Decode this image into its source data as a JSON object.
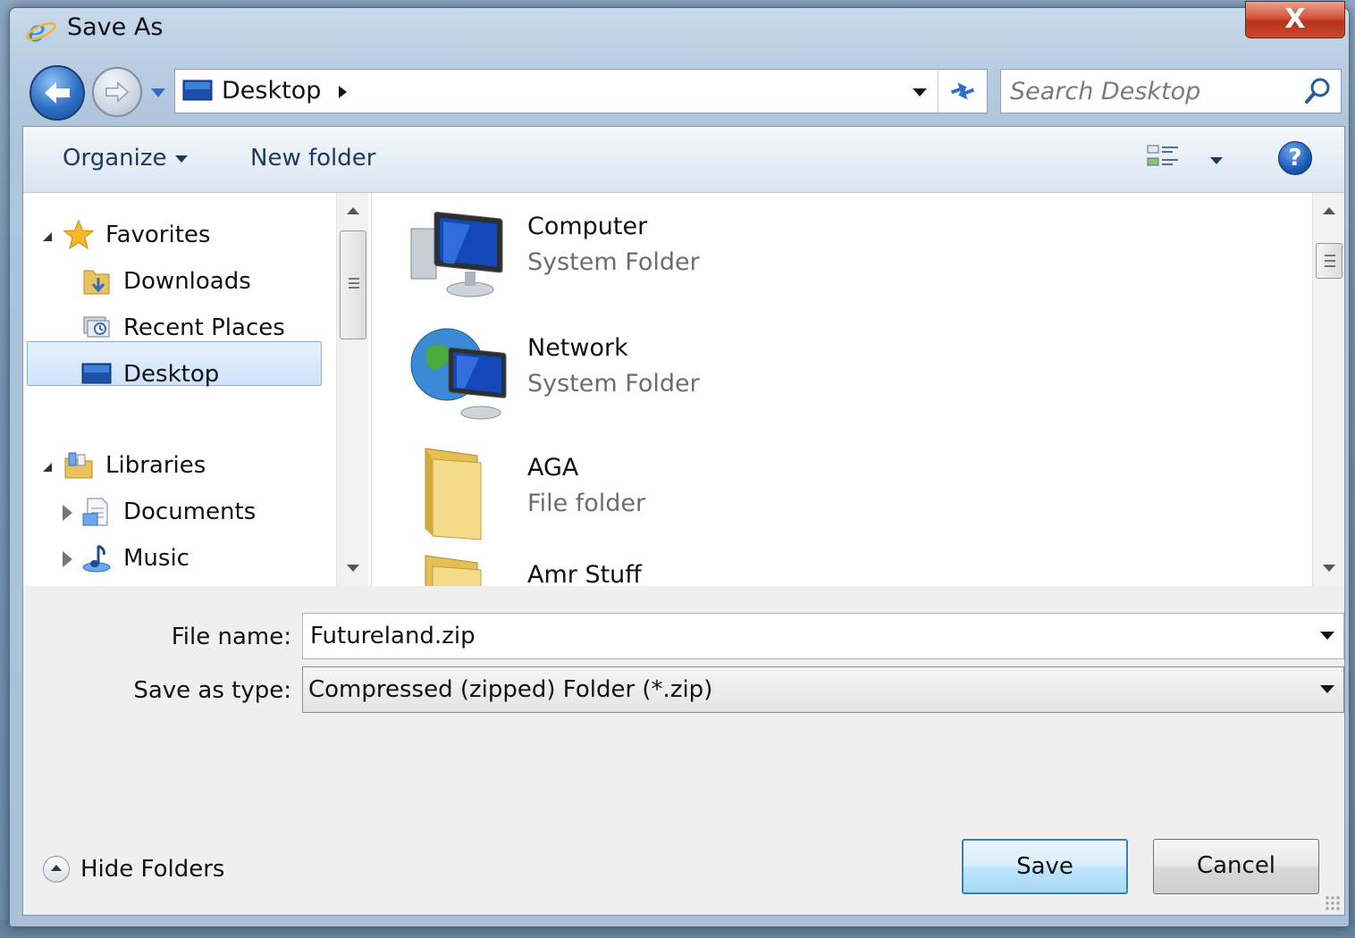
{
  "window": {
    "title": "Save As",
    "close_label": "X"
  },
  "address": {
    "location": "Desktop",
    "search_placeholder": "Search Desktop"
  },
  "toolbar": {
    "organize_label": "Organize",
    "new_folder_label": "New folder",
    "help_label": "?"
  },
  "nav": {
    "favorites_label": "Favorites",
    "favorites": [
      {
        "label": "Downloads"
      },
      {
        "label": "Recent Places"
      },
      {
        "label": "Desktop"
      }
    ],
    "libraries_label": "Libraries",
    "libraries": [
      {
        "label": "Documents"
      },
      {
        "label": "Music"
      }
    ],
    "selected": "Desktop"
  },
  "files": [
    {
      "name": "Computer",
      "type": "System Folder",
      "icon": "computer-icon"
    },
    {
      "name": "Network",
      "type": "System Folder",
      "icon": "network-icon"
    },
    {
      "name": "AGA",
      "type": "File folder",
      "icon": "folder-icon"
    },
    {
      "name": "Amr Stuff",
      "type": "",
      "icon": "folder-icon"
    }
  ],
  "form": {
    "file_name_label": "File name:",
    "file_name_value": "Futureland.zip",
    "save_type_label": "Save as type:",
    "save_type_value": "Compressed (zipped) Folder (*.zip)"
  },
  "footer": {
    "hide_folders_label": "Hide Folders",
    "save_label": "Save",
    "cancel_label": "Cancel"
  },
  "colors": {
    "accent": "#3c7fb1",
    "close": "#c94a2c",
    "selection": "#cfe3fc"
  }
}
